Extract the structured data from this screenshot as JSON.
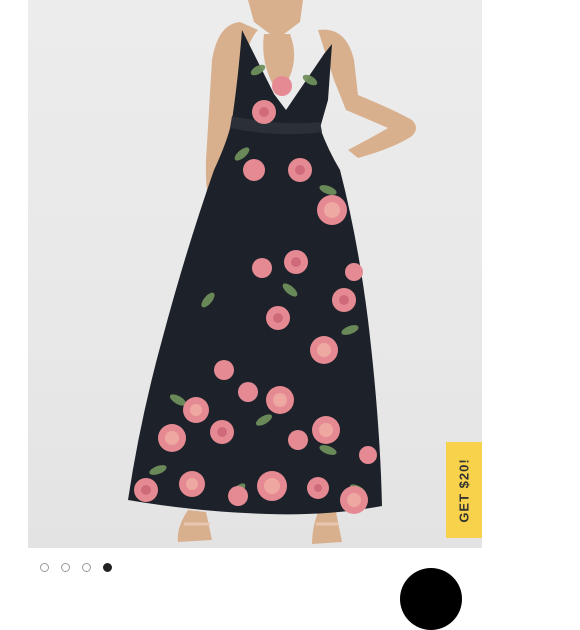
{
  "listing": {
    "photo_alt": "",
    "carousel": {
      "count": 4,
      "active_index": 3
    },
    "promo_badge": {
      "label": "GET $20!",
      "color": "#f7d24a"
    },
    "colors": {
      "dress": "#1d2129",
      "rose": "#e58a93",
      "leaf": "#6f8f5c"
    }
  }
}
